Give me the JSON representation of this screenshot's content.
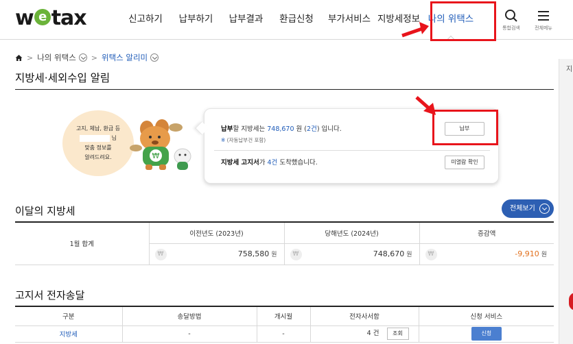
{
  "header": {
    "logo_text": "wetax",
    "nav": [
      "신고하기",
      "납부하기",
      "납부결과",
      "환급신청",
      "부가서비스",
      "지방세정보",
      "나의 위택스"
    ],
    "active_nav_index": 6,
    "search_caption": "통합검색",
    "menu_caption": "전체메뉴"
  },
  "side": {
    "label": "지"
  },
  "breadcrumb": {
    "level1": "나의 위택스",
    "level2": "위택스 알리미"
  },
  "page": {
    "title": "지방세·세외수입 알림"
  },
  "notice": {
    "line1": "고지, 체납, 환급 등",
    "line2_suffix": "님",
    "line3": "맞춤 정보를",
    "line4": "알려드려요."
  },
  "alarm": {
    "pay_prefix_bold": "납부",
    "pay_mid": "할 지방세는 ",
    "pay_amount": "748,670",
    "pay_won": " 원 (",
    "pay_count": "2건",
    "pay_tail": ") 입니다.",
    "pay_note_mark": "※",
    "pay_note": " (자동납부건 포함)",
    "pay_button": "납부",
    "bill_bold": "지방세 고지서",
    "bill_mid": "가 ",
    "bill_count": "4건",
    "bill_tail": " 도착했습니다.",
    "bill_button": "미열람 확인"
  },
  "monthly": {
    "title": "이달의 지방세",
    "view_all": "전체보기",
    "row_label": "1월 합계",
    "columns": [
      "이전년도 (2023년)",
      "당해년도 (2024년)",
      "증감액"
    ],
    "values": [
      "758,580",
      "748,670",
      "-9,910"
    ],
    "unit": "원",
    "won_symbol": "₩"
  },
  "transmission": {
    "title": "고지서 전자송달",
    "columns": [
      "구분",
      "송달방법",
      "개시월",
      "전자사서함",
      "신청 서비스"
    ],
    "rows": [
      {
        "type": "지방세",
        "method": "-",
        "start": "-",
        "box_count": "4 건",
        "box_button": "조회",
        "service_button": "신청"
      }
    ]
  },
  "colors": {
    "accent": "#1e5bb8",
    "button_blue": "#2d5fb3",
    "annotation_red": "#e8141b",
    "negative": "#e2701d"
  }
}
